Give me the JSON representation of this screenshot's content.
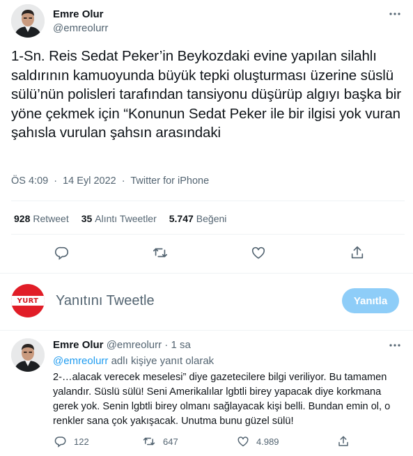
{
  "main_tweet": {
    "display_name": "Emre Olur",
    "handle": "@emreolurr",
    "text": "1-Sn. Reis Sedat Peker’in Beykozdaki evine yapılan silahlı saldırının kamuoyunda büyük tepki oluşturması üzerine süslü sülü’nün polisleri tarafından tansiyonu düşürüp algıyı başka bir yöne çekmek için “Konunun Sedat Peker ile bir ilgisi yok vuran şahısla vurulan şahsın arasındaki",
    "time": "ÖS 4:09",
    "date": "14 Eyl 2022",
    "separator": "·",
    "source": "Twitter for iPhone",
    "stats": {
      "retweets_value": "928",
      "retweets_label": "Retweet",
      "quotes_value": "35",
      "quotes_label": "Alıntı Tweetler",
      "likes_value": "5.747",
      "likes_label": "Beğeni"
    }
  },
  "composer": {
    "avatar_text": "YURT",
    "placeholder": "Yanıtını Tweetle",
    "reply_button": "Yanıtla"
  },
  "reply_tweet": {
    "display_name": "Emre Olur",
    "handle": "@emreolurr",
    "dot": "·",
    "time": "1 sa",
    "replying_mention": "@emreolurr",
    "replying_suffix": " adlı kişiye yanıt olarak",
    "text": "2-…alacak verecek meselesi” diye gazetecilere bilgi veriliyor. Bu tamamen yalandır. Süslü sülü! Seni Amerikalılar lgbtli birey yapacak diye korkmana gerek yok. Senin lgbtli birey olmanı sağlayacak kişi belli. Bundan emin ol, o renkler sana çok yakışacak. Unutma bunu güzel sülü!",
    "replies": "122",
    "retweets": "647",
    "likes": "4.989"
  },
  "icons": [
    "more-icon",
    "reply-icon",
    "retweet-icon",
    "like-icon",
    "share-icon"
  ],
  "colors": {
    "text": "#0f1419",
    "secondary": "#536471",
    "accent": "#1d9bf0",
    "button_disabled": "#8ecdf8",
    "divider": "#eff3f4",
    "yurt_red": "#e11d27"
  }
}
